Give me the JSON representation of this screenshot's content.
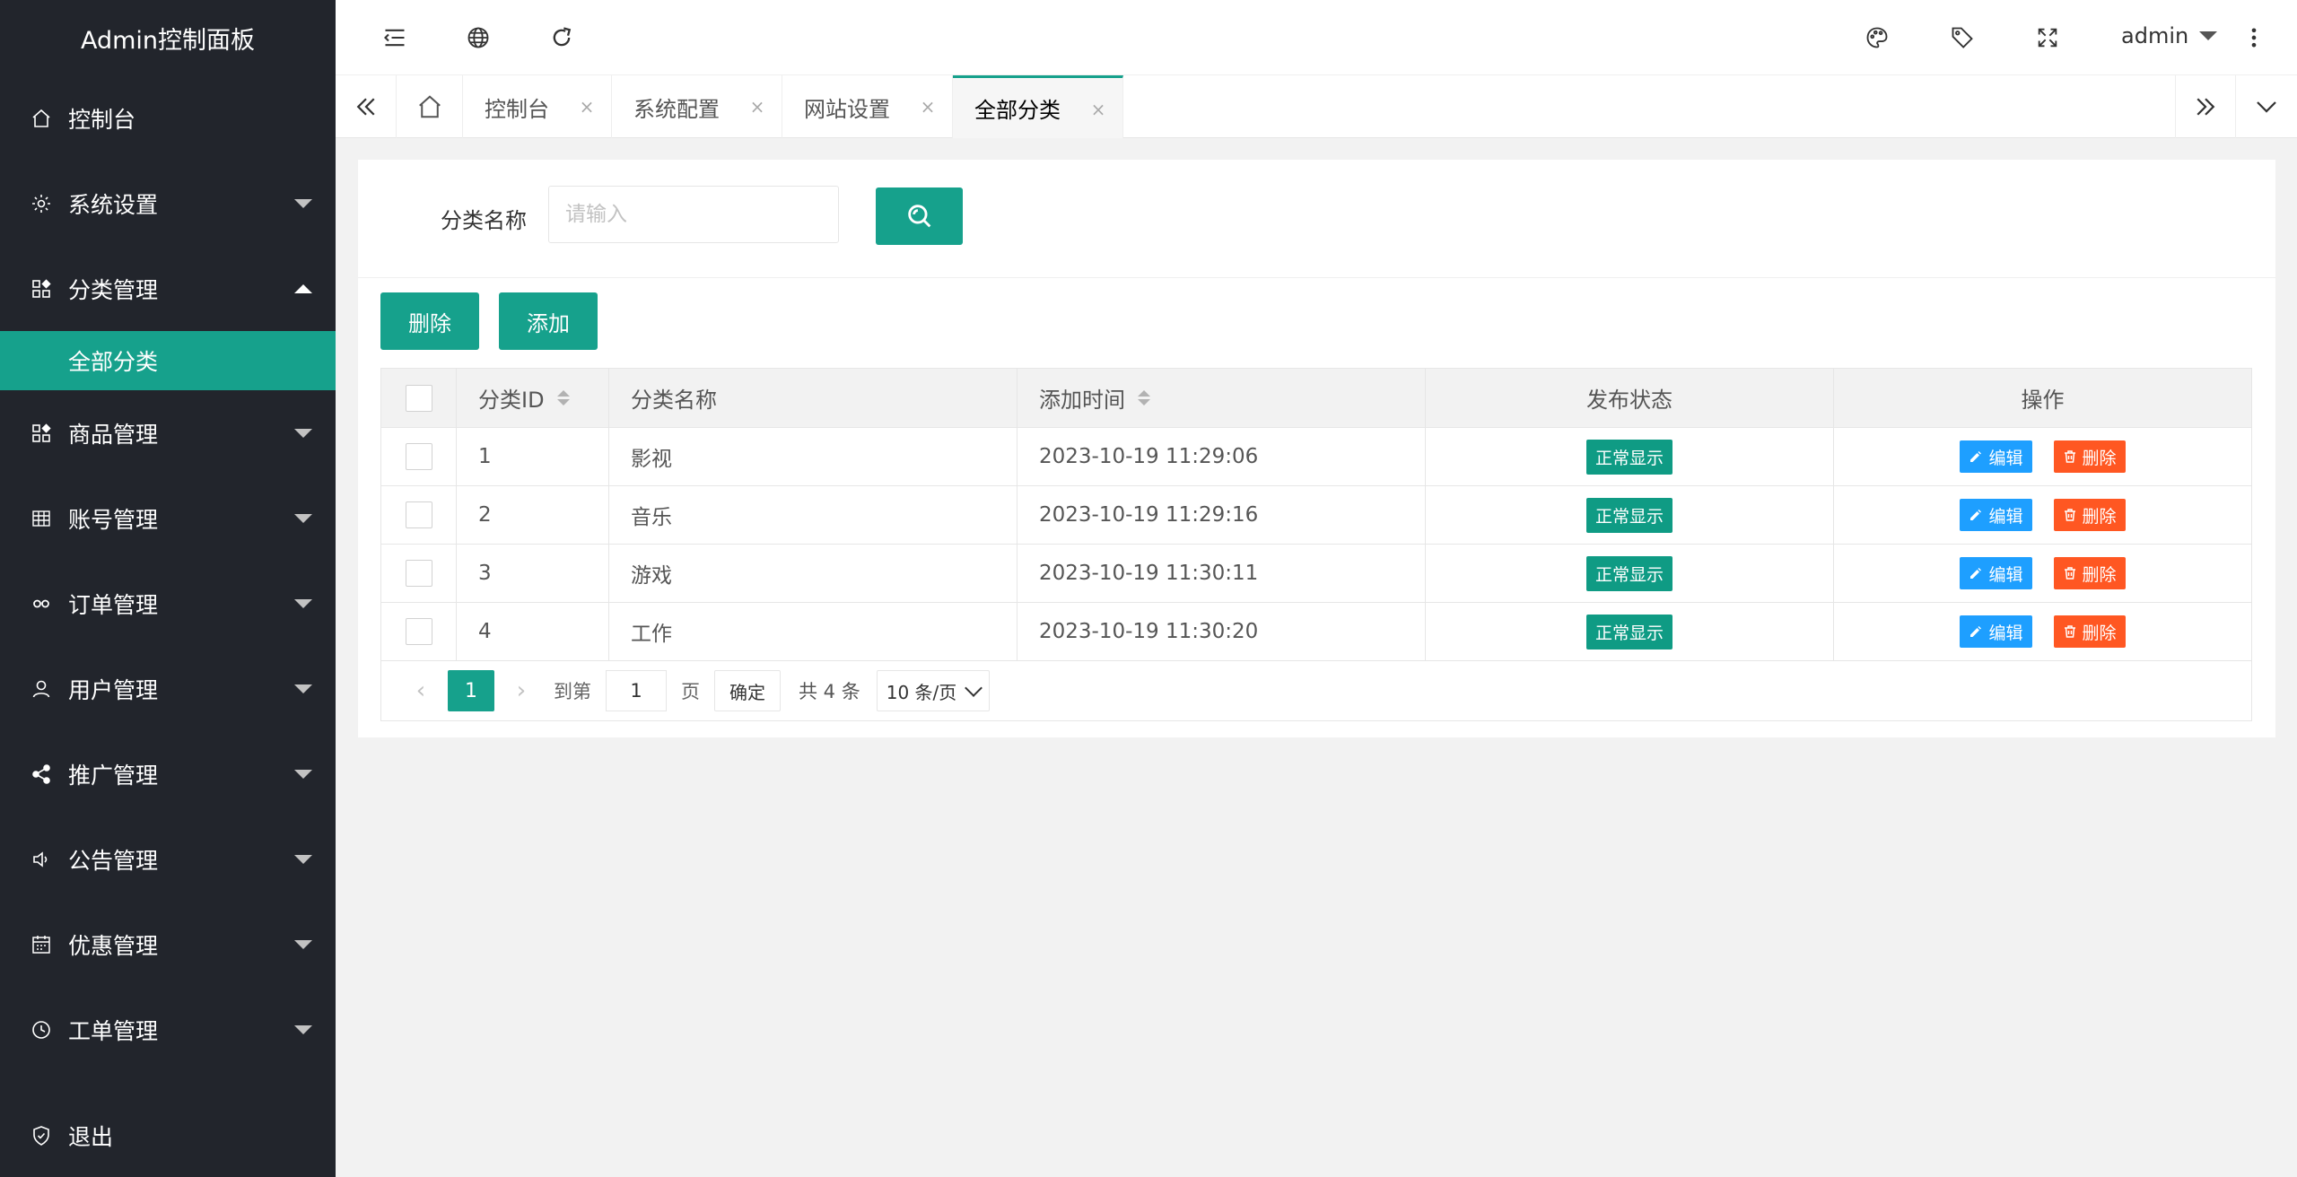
{
  "app": {
    "title": "Admin控制面板"
  },
  "sidebar": {
    "items": [
      {
        "label": "控制台",
        "icon": "home-icon"
      },
      {
        "label": "系统设置",
        "icon": "gear-icon"
      },
      {
        "label": "分类管理",
        "icon": "apps-icon",
        "expanded": true
      },
      {
        "label": "全部分类",
        "active": true
      },
      {
        "label": "商品管理",
        "icon": "apps-icon"
      },
      {
        "label": "账号管理",
        "icon": "grid-icon"
      },
      {
        "label": "订单管理",
        "icon": "link-icon"
      },
      {
        "label": "用户管理",
        "icon": "user-icon"
      },
      {
        "label": "推广管理",
        "icon": "share-icon"
      },
      {
        "label": "公告管理",
        "icon": "speaker-icon"
      },
      {
        "label": "优惠管理",
        "icon": "calendar-icon"
      },
      {
        "label": "工单管理",
        "icon": "clock-icon"
      },
      {
        "label": "退出",
        "icon": "shield-icon"
      }
    ]
  },
  "header": {
    "user": "admin"
  },
  "tabs": [
    {
      "label": "控制台"
    },
    {
      "label": "系统配置"
    },
    {
      "label": "网站设置"
    },
    {
      "label": "全部分类",
      "active": true
    }
  ],
  "search": {
    "label": "分类名称",
    "placeholder": "请输入"
  },
  "actions": {
    "delete_label": "删除",
    "add_label": "添加"
  },
  "table": {
    "headers": {
      "id": "分类ID",
      "name": "分类名称",
      "time": "添加时间",
      "status": "发布状态",
      "ops": "操作"
    },
    "rows": [
      {
        "id": "1",
        "name": "影视",
        "time": "2023-10-19 11:29:06",
        "status": "正常显示"
      },
      {
        "id": "2",
        "name": "音乐",
        "time": "2023-10-19 11:29:16",
        "status": "正常显示"
      },
      {
        "id": "3",
        "name": "游戏",
        "time": "2023-10-19 11:30:11",
        "status": "正常显示"
      },
      {
        "id": "4",
        "name": "工作",
        "time": "2023-10-19 11:30:20",
        "status": "正常显示"
      }
    ],
    "edit_label": "编辑",
    "delete_label": "删除"
  },
  "pagination": {
    "current": "1",
    "goto_label": "到第",
    "goto_value": "1",
    "page_label": "页",
    "confirm_label": "确定",
    "total_label": "共 4 条",
    "page_size": "10 条/页"
  },
  "colors": {
    "sidebar_bg": "#22252c",
    "accent": "#16a18c",
    "edit": "#1e9fff",
    "delete": "#ff5722"
  }
}
